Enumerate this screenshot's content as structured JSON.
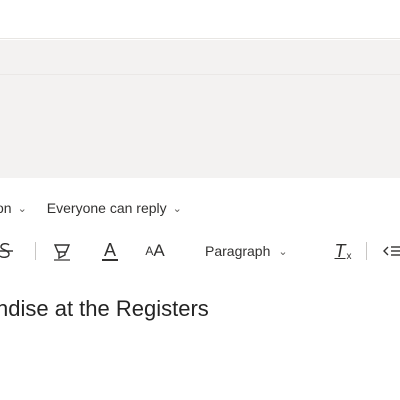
{
  "options": {
    "audience_label": "on",
    "reply_label": "Everyone can reply"
  },
  "toolbar": {
    "icons": [
      "strikethrough-icon",
      "highlight-icon",
      "font-color-icon",
      "font-size-icon",
      "clear-formatting-icon",
      "decrease-indent-icon"
    ],
    "font_color_glyph": "A",
    "font_size_glyph_large": "A",
    "font_size_glyph_small": "A",
    "paragraph_label": "Paragraph",
    "clear_glyph": "T",
    "clear_sub": "x"
  },
  "post": {
    "subject": "ndise at the Registers"
  },
  "colors": {
    "panel": "#f3f2f1",
    "text": "#323130",
    "separator": "#c8c6c4"
  }
}
